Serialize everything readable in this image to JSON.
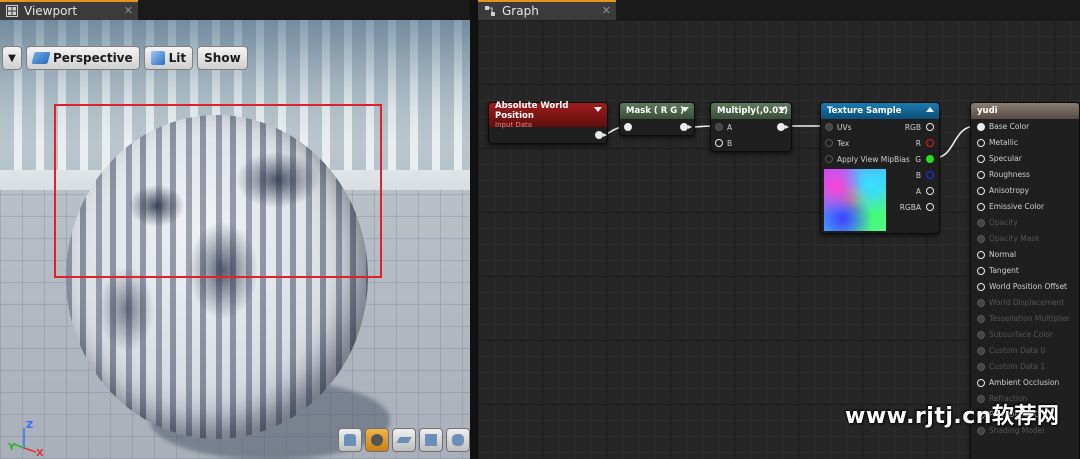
{
  "viewport": {
    "tab_title": "Viewport",
    "toolbar": {
      "perspective_label": "Perspective",
      "lit_label": "Lit",
      "show_label": "Show"
    },
    "axes": {
      "z": "Z",
      "y": "Y",
      "x": "X"
    }
  },
  "graph": {
    "tab_title": "Graph",
    "nodes": {
      "absolute_world_position": {
        "title": "Absolute World Position",
        "subtitle": "Input Data"
      },
      "mask": {
        "title": "Mask ( R G )"
      },
      "multiply": {
        "title": "Multiply(,0.01)",
        "pins": [
          "A",
          "B"
        ]
      },
      "texture_sample": {
        "title": "Texture Sample",
        "inputs": [
          "UVs",
          "Tex",
          "Apply View MipBias"
        ],
        "outputs": [
          "RGB",
          "R",
          "G",
          "B",
          "A",
          "RGBA"
        ]
      },
      "result": {
        "title": "yudi",
        "pins": [
          "Base Color",
          "Metallic",
          "Specular",
          "Roughness",
          "Anisotropy",
          "Emissive Color",
          "Opacity",
          "Opacity Mask",
          "Normal",
          "Tangent",
          "World Position Offset",
          "World Displacement",
          "Tessellation Multiplier",
          "Subsurface Color",
          "Custom Data 0",
          "Custom Data 1",
          "Ambient Occlusion",
          "Refraction",
          "Pixel Depth Offset",
          "Shading Model"
        ]
      }
    }
  },
  "watermark": "www.rjtj.cn软荐网",
  "colors": {
    "selection_rect": "#e0202a",
    "tab_accent": "#e3941c",
    "input_node": "#9e1c1c",
    "math_node": "#5e7a5e",
    "texture_node": "#1a7cb1",
    "result_node": "#8a7d72"
  }
}
